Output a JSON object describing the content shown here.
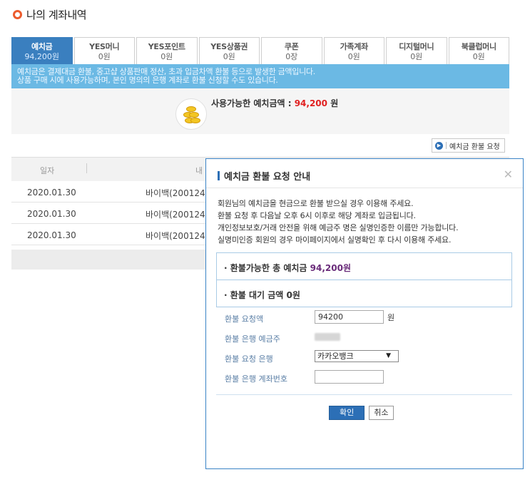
{
  "page": {
    "title": "나의 계좌내역"
  },
  "tabs": [
    {
      "label": "예치금",
      "value": "94,200원",
      "active": true
    },
    {
      "label": "YES머니",
      "value": "0원"
    },
    {
      "label": "YES포인트",
      "value": "0원"
    },
    {
      "label": "YES상품권",
      "value": "0원"
    },
    {
      "label": "쿠폰",
      "value": "0장"
    },
    {
      "label": "가족계좌",
      "value": "0원"
    },
    {
      "label": "디지털머니",
      "value": "0원"
    },
    {
      "label": "북클럽머니",
      "value": "0원"
    }
  ],
  "notice": {
    "line1": "예치금은 결제대금 환불, 중고샵 상품판매 정산, 초과 입금차액 환불 등으로 발생한 금액입니다.",
    "line2": "상품 구매 시에 사용가능하며, 본인 명의의 은행 계좌로 환불 신청할 수도 있습니다."
  },
  "balance": {
    "label": "사용가능한 예치금액 : ",
    "amount": "94,200",
    "unit": " 원"
  },
  "refund_request_button": "예치금 환불 요청",
  "table": {
    "headers": [
      "일자",
      "내"
    ],
    "rows": [
      {
        "date": "2020.01.30",
        "desc": "바이백(200124-"
      },
      {
        "date": "2020.01.30",
        "desc": "바이백(200124-"
      },
      {
        "date": "2020.01.30",
        "desc": "바이백(200124-"
      }
    ]
  },
  "modal": {
    "title": "예치금 환불 요청 안내",
    "close": "✕",
    "lines": [
      "회원님의 예치금을 현금으로 환불 받으실 경우 이용해 주세요.",
      "환불 요청 후 다음날 오후 6시 이후로 해당 계좌로 입금됩니다.",
      "개인정보보호/거래 안전을 위해 예금주 명은 실명인증한 이름만 가능합니다.",
      "실명미인증 회원의 경우 마이페이지에서 실명확인 후 다시 이용해 주세요."
    ],
    "total_label": "· 환불가능한 총 예치금 ",
    "total_amount": "94,200원",
    "pending_label": "· 환불 대기 금액 0원",
    "form": {
      "amount_label": "환불 요청액",
      "amount_value": "94200",
      "amount_unit": "원",
      "holder_label": "환불 은행 예금주",
      "bank_label": "환불 요청 은행",
      "bank_value": "카카오뱅크",
      "account_label": "환불 은행 계좌번호",
      "account_value": ""
    },
    "ok": "확인",
    "cancel": "취소"
  }
}
